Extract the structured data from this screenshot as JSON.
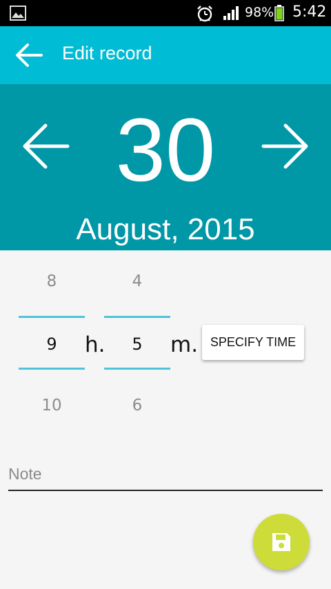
{
  "status_bar": {
    "battery_percent": "98%",
    "time": "5:42",
    "icons": [
      "gallery-icon",
      "alarm-icon",
      "signal-icon",
      "battery-icon"
    ]
  },
  "app_bar": {
    "title": "Edit record",
    "icon": "arrow-back-icon",
    "color": "#00bcd4"
  },
  "date": {
    "day": "30",
    "month_year": "August, 2015",
    "color": "#0097a7",
    "prev_icon": "arrow-left-icon",
    "next_icon": "arrow-right-icon"
  },
  "time_picker": {
    "hours": {
      "above": "8",
      "current": "9",
      "below": "10",
      "unit": "h."
    },
    "minutes": {
      "above": "4",
      "current": "5",
      "below": "6",
      "unit": "m."
    },
    "specify_label": "SPECIFY TIME",
    "accent": "#4fc3d9"
  },
  "note": {
    "placeholder": "Note",
    "value": ""
  },
  "fab": {
    "icon": "save-icon",
    "color": "#cddc39"
  }
}
